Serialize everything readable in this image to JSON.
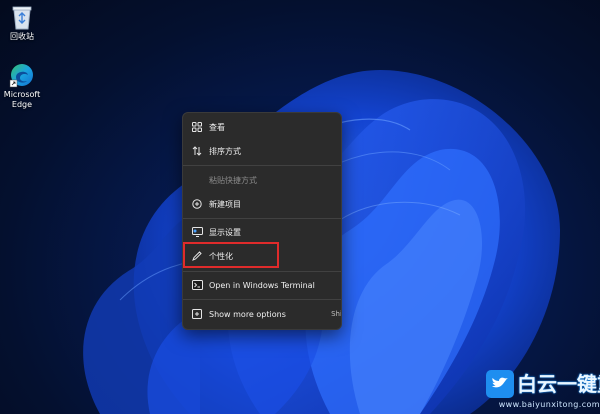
{
  "desktop": {
    "icons": [
      {
        "name": "recycle-bin",
        "label": "回收站"
      },
      {
        "name": "microsoft-edge",
        "label": "Microsoft\nEdge"
      }
    ]
  },
  "context_menu": {
    "items": [
      {
        "label": "查看",
        "icon": "grid-icon",
        "enabled": true
      },
      {
        "label": "排序方式",
        "icon": "sort-icon",
        "enabled": true
      },
      {
        "label": "粘贴快捷方式",
        "icon": "none",
        "enabled": false
      },
      {
        "label": "新建项目",
        "icon": "plus-circle-icon",
        "enabled": true
      },
      {
        "label": "显示设置",
        "icon": "display-icon",
        "enabled": true
      },
      {
        "label": "个性化",
        "icon": "pen-icon",
        "enabled": true,
        "highlighted": true
      },
      {
        "label": "Open in Windows Terminal",
        "icon": "terminal-icon",
        "enabled": true
      },
      {
        "label": "Show more options",
        "icon": "more-options-icon",
        "enabled": true,
        "shortcut": "Shift"
      }
    ],
    "highlight_color": "#e02b2b"
  },
  "watermark": {
    "title": "白云一键重装系统",
    "url": "www.baiyunxitong.com",
    "color": "#1e8ef0"
  }
}
